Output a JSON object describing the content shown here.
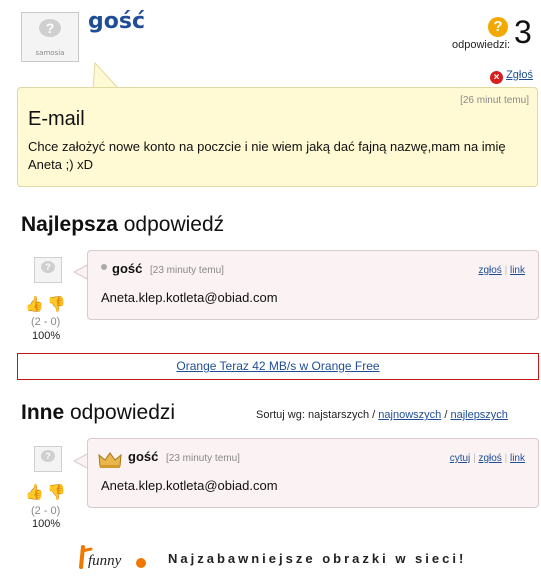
{
  "question": {
    "username": "gość",
    "avatar_logo": "samosia",
    "answers_label": "odpowiedzi:",
    "answers_count": "3",
    "report_label": "Zgłoś",
    "time": "[26 minut temu]",
    "title": "E-mail",
    "body": "Chce założyć nowe konto na poczcie i nie wiem jaką dać fajną nazwę,mam na imię Aneta ;) xD"
  },
  "best": {
    "heading_bold": "Najlepsza",
    "heading_rest": " odpowiedź",
    "answer": {
      "username": "gość",
      "time": "[23 minuty temu]",
      "link_report": "zgłoś",
      "link_link": "link",
      "text": "Aneta.klep.kotleta@obiad.com",
      "score": "(2 - 0)",
      "percent": "100%"
    }
  },
  "ad": {
    "text": "Orange Teraz 42 MB/s w Orange Free"
  },
  "others": {
    "heading_bold": "Inne",
    "heading_rest": " odpowiedzi",
    "sort_label": "Sortuj wg: najstarszych /",
    "sort_newest": "najnowszych",
    "sort_sep": "/",
    "sort_best": "najlepszych",
    "answer": {
      "username": "gość",
      "time": "[23 minuty temu]",
      "link_quote": "cytuj",
      "link_report": "zgłoś",
      "link_link": "link",
      "text": "Aneta.klep.kotleta@obiad.com",
      "score": "(2 - 0)",
      "percent": "100%"
    }
  },
  "footer": {
    "logo_text": "funny",
    "tagline": "Najzabawniejsze obrazki w sieci!"
  },
  "icons": {
    "question_badge": "question-mark-icon",
    "report": "close-icon",
    "thumbs_up": "thumbs-up-icon",
    "thumbs_down": "thumbs-down-icon",
    "crown": "crown-icon"
  },
  "colors": {
    "link": "#1f4e96",
    "question_bg": "#fff9d4",
    "answer_bg": "#fbf2f3",
    "ad_border": "#c41616",
    "badge": "#f3a800"
  }
}
